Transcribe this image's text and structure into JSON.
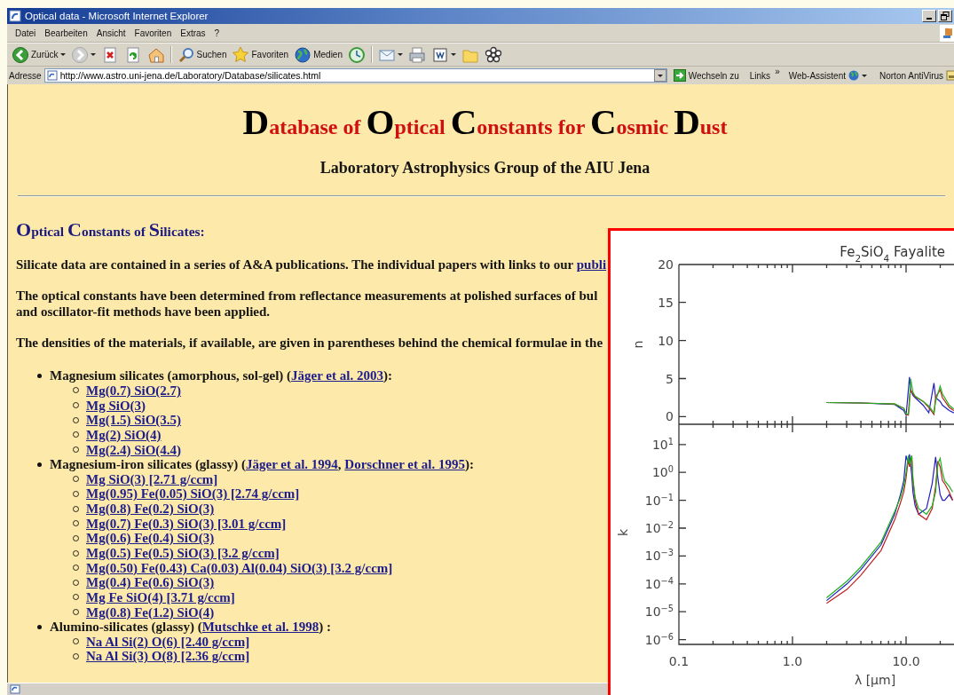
{
  "window": {
    "title": "Optical data - Microsoft Internet Explorer"
  },
  "menu": [
    "Datei",
    "Bearbeiten",
    "Ansicht",
    "Favoriten",
    "Extras",
    "?"
  ],
  "toolbar": [
    [
      {
        "kind": "back",
        "label": "Zurück"
      },
      {
        "kind": "forward"
      },
      {
        "kind": "stop"
      },
      {
        "kind": "refresh"
      },
      {
        "kind": "home"
      }
    ],
    [
      {
        "kind": "search",
        "label": "Suchen"
      },
      {
        "kind": "favorites",
        "label": "Favoriten"
      },
      {
        "kind": "media",
        "label": "Medien"
      },
      {
        "kind": "history"
      }
    ],
    [
      {
        "kind": "mail"
      },
      {
        "kind": "print"
      },
      {
        "kind": "edit"
      },
      {
        "kind": "folder"
      },
      {
        "kind": "flower"
      }
    ]
  ],
  "address_bar": {
    "label": "Adresse",
    "url": "http://www.astro.uni-jena.de/Laboratory/Database/silicates.html",
    "go": "Wechseln zu",
    "links": "Links",
    "more": "»",
    "assistant": "Web-Assistent",
    "antivirus": "Norton AntiVirus"
  },
  "page": {
    "title_parts": [
      {
        "initial": "D",
        "rest": "atabase of"
      },
      {
        "initial": "O",
        "rest": "ptical"
      },
      {
        "initial": "C",
        "rest": "onstants for"
      },
      {
        "initial": "C",
        "rest": "osmic"
      },
      {
        "initial": "D",
        "rest": "ust"
      }
    ],
    "subtitle": "Laboratory Astrophysics Group of the AIU Jena",
    "section_parts": [
      {
        "initial": "O",
        "rest": "ptical"
      },
      {
        "initial": "C",
        "rest": "onstants of"
      },
      {
        "initial": "S",
        "rest": "ilicates:"
      }
    ],
    "paragraphs": [
      {
        "lines": [
          [
            {
              "text": "Silicate data are contained in a series of A&A publications. The individual papers with links to our "
            },
            {
              "link": "publi"
            }
          ]
        ]
      },
      {
        "lines": [
          [
            {
              "text": "The optical constants have been determined from reflectance measurements at polished surfaces of bul"
            }
          ],
          [
            {
              "text": "and oscillator-fit methods have been applied."
            }
          ]
        ]
      },
      {
        "lines": [
          [
            {
              "text": "The densities of the materials, if available, are given in parentheses behind the chemical formulae in the"
            }
          ]
        ]
      }
    ],
    "groups": [
      {
        "parts": [
          {
            "text": "Magnesium silicates (amorphous, sol-gel) ("
          },
          {
            "link": "Jäger et al. 2003"
          },
          {
            "text": "):"
          }
        ],
        "items": [
          "Mg(0.7) SiO(2.7)",
          "Mg SiO(3)",
          "Mg(1.5) SiO(3.5)",
          "Mg(2) SiO(4)",
          "Mg(2.4) SiO(4.4)"
        ]
      },
      {
        "parts": [
          {
            "text": "Magnesium-iron silicates (glassy) ("
          },
          {
            "link": "Jäger et al. 1994"
          },
          {
            "text": ", "
          },
          {
            "link": "Dorschner et al. 1995"
          },
          {
            "text": "):"
          }
        ],
        "items": [
          "Mg SiO(3) [2.71 g/ccm]",
          "Mg(0.95) Fe(0.05) SiO(3) [2.74 g/ccm]",
          "Mg(0.8) Fe(0.2) SiO(3)",
          "Mg(0.7) Fe(0.3) SiO(3) [3.01 g/ccm]",
          "Mg(0.6) Fe(0.4) SiO(3)",
          "Mg(0.5) Fe(0.5) SiO(3) [3.2 g/ccm]",
          "Mg(0.50) Fe(0.43) Ca(0.03) Al(0.04) SiO(3) [3.2 g/ccm]",
          "Mg(0.4) Fe(0.6) SiO(3)",
          "Mg Fe SiO(4) [3.71 g/ccm]",
          "Mg(0.8) Fe(1.2) SiO(4)"
        ]
      },
      {
        "parts": [
          {
            "text": "Alumino-silicates (glassy) ("
          },
          {
            "link": "Mutschke et al. 1998"
          },
          {
            "text": ") :"
          }
        ],
        "items": [
          "Na Al Si(2) O(6) [2.40 g/ccm]",
          "Na Al Si(3) O(8) [2.36 g/ccm]"
        ]
      }
    ]
  },
  "chart_inset": {
    "n_panel": {
      "title": "Fe$_{2}$SiO$_{4}$ Fayalite",
      "ylabel": "n",
      "yticks": [
        "20",
        "15",
        "10",
        "5",
        "0"
      ]
    },
    "k_panel": {
      "ylabel": "k",
      "yticks": [
        "10$^{1}$",
        "10$^{0}$",
        "10$^{−1}$",
        "10$^{−2}$",
        "10$^{−3}$",
        "10$^{−4}$",
        "10$^{−5}$",
        "10$^{−6}$"
      ],
      "xticks": [
        "0.1",
        "1.0",
        "10.0"
      ],
      "xlabel": "λ [μm]"
    }
  }
}
